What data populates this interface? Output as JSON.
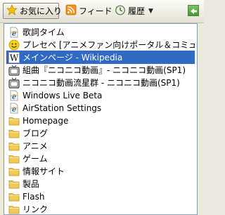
{
  "toolbar": {
    "favorites_label": "お気に入り",
    "feeds_label": "フィード",
    "history_label": "履歴",
    "history_arrow": "▼"
  },
  "items": [
    {
      "label": "歌詞タイム",
      "icon": "ie-page-icon",
      "selected": false
    },
    {
      "label": "プレセペ [アニメファン向けポータル＆コミュニティサ…",
      "icon": "smiley-icon",
      "selected": false
    },
    {
      "label": "メインページ - Wikipedia",
      "icon": "wikipedia-icon",
      "selected": true
    },
    {
      "label": "組曲『ニコニコ動画』- ニコニコ動画(SP1)",
      "icon": "tv-icon",
      "selected": false
    },
    {
      "label": "ニコニコ動画流星群 - ニコニコ動画(SP1)",
      "icon": "tv-icon",
      "selected": false
    },
    {
      "label": "Windows Live Beta",
      "icon": "ie-page-icon",
      "selected": false
    },
    {
      "label": "AirStation Settings",
      "icon": "ie-page-icon",
      "selected": false
    },
    {
      "label": "Homepage",
      "icon": "folder-icon",
      "selected": false
    },
    {
      "label": "ブログ",
      "icon": "folder-icon",
      "selected": false
    },
    {
      "label": "アニメ",
      "icon": "folder-icon",
      "selected": false
    },
    {
      "label": "ゲーム",
      "icon": "folder-icon",
      "selected": false
    },
    {
      "label": "情報サイト",
      "icon": "folder-icon",
      "selected": false
    },
    {
      "label": "製品",
      "icon": "folder-icon",
      "selected": false
    },
    {
      "label": "Flash",
      "icon": "folder-icon",
      "selected": false
    },
    {
      "label": "リンク",
      "icon": "folder-icon",
      "selected": false
    }
  ],
  "colors": {
    "selection": "#316ac5",
    "folder": "#f2c955",
    "ie_blue": "#1c66c9"
  }
}
